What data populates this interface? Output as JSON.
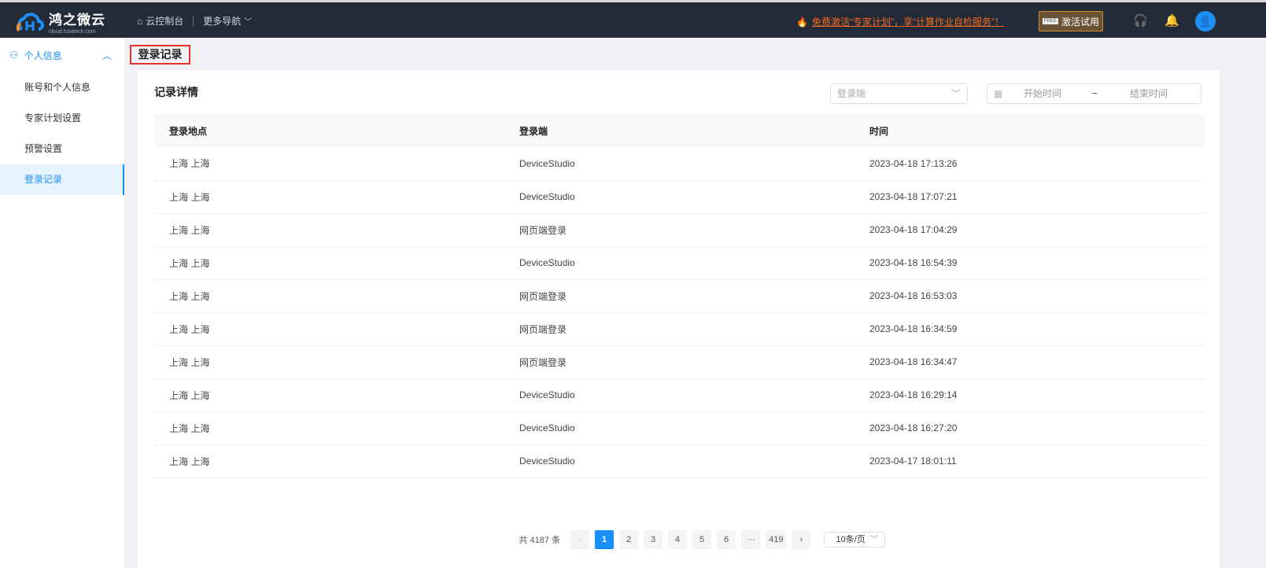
{
  "header": {
    "logo_name": "鸿之微云",
    "logo_sub": "cloud.hzwtech.com",
    "console": "云控制台",
    "more_nav": "更多导航",
    "promo": "免费激活“专家计划”，享“计算作业自检服务”！",
    "trial_button": "激活试用",
    "trial_badge": "FREE"
  },
  "sidebar": {
    "group": "个人信息",
    "items": [
      {
        "label": "账号和个人信息"
      },
      {
        "label": "专家计划设置"
      },
      {
        "label": "预警设置"
      },
      {
        "label": "登录记录"
      }
    ]
  },
  "page_title": "登录记录",
  "card": {
    "title": "记录详情",
    "terminal_placeholder": "登录端",
    "start_placeholder": "开始时间",
    "range_sep": "~",
    "end_placeholder": "结束时间"
  },
  "table": {
    "headers": [
      "登录地点",
      "登录端",
      "时间"
    ],
    "rows": [
      [
        "上海 上海",
        "DeviceStudio",
        "2023-04-18 17:13:26"
      ],
      [
        "上海 上海",
        "DeviceStudio",
        "2023-04-18 17:07:21"
      ],
      [
        "上海 上海",
        "网页端登录",
        "2023-04-18 17:04:29"
      ],
      [
        "上海 上海",
        "DeviceStudio",
        "2023-04-18 16:54:39"
      ],
      [
        "上海 上海",
        "网页端登录",
        "2023-04-18 16:53:03"
      ],
      [
        "上海 上海",
        "网页端登录",
        "2023-04-18 16:34:59"
      ],
      [
        "上海 上海",
        "网页端登录",
        "2023-04-18 16:34:47"
      ],
      [
        "上海 上海",
        "DeviceStudio",
        "2023-04-18 16:29:14"
      ],
      [
        "上海 上海",
        "DeviceStudio",
        "2023-04-18 16:27:20"
      ],
      [
        "上海 上海",
        "DeviceStudio",
        "2023-04-17 18:01:11"
      ]
    ]
  },
  "pagination": {
    "total": "共 4187 条",
    "pages": [
      "1",
      "2",
      "3",
      "4",
      "5",
      "6"
    ],
    "ellipsis": "···",
    "last": "419",
    "current": "1",
    "page_size": "10条/页"
  }
}
